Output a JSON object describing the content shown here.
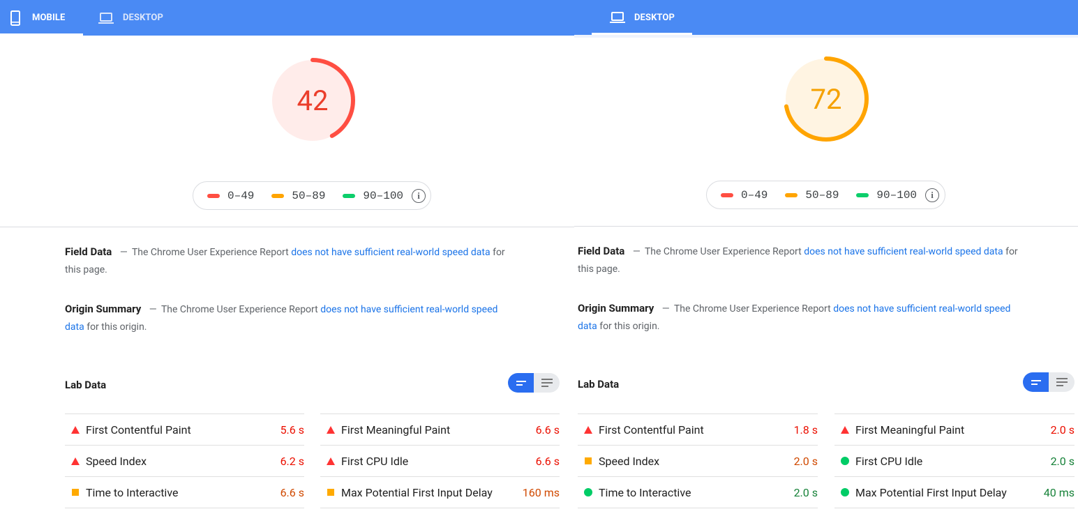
{
  "colors": {
    "fail": "#ff4e42",
    "average": "#ffa400",
    "pass": "#0cce6b",
    "fail_text": "#eb0f00",
    "average_text": "#d04900",
    "pass_text": "#178239",
    "link": "#1a73e8",
    "brand_blue": "#4a8af4"
  },
  "mobile_panel": {
    "tabs": [
      {
        "label": "MOBILE",
        "icon": "smartphone-icon",
        "active": true
      },
      {
        "label": "DESKTOP",
        "icon": "laptop-icon",
        "active": false
      }
    ],
    "score": {
      "value": 42,
      "fraction": 0.42,
      "rating": "fail"
    },
    "legend": {
      "ranges": [
        "0–49",
        "50–89",
        "90–100"
      ],
      "info_icon": "info-icon"
    },
    "field_data": {
      "heading": "Field Data",
      "dash": "—",
      "text_before": "The Chrome User Experience Report",
      "link_text": "does not have sufficient real-world speed data",
      "text_after": "for this page."
    },
    "origin_summary": {
      "heading": "Origin Summary",
      "dash": "—",
      "text_before": "The Chrome User Experience Report",
      "link_text": "does not have sufficient real-world speed data",
      "text_after": "for this origin."
    },
    "lab_data": {
      "title": "Lab Data",
      "metrics": [
        {
          "name": "First Contentful Paint",
          "value": "5.6 s",
          "rating": "fail"
        },
        {
          "name": "First Meaningful Paint",
          "value": "6.6 s",
          "rating": "fail"
        },
        {
          "name": "Speed Index",
          "value": "6.2 s",
          "rating": "fail"
        },
        {
          "name": "First CPU Idle",
          "value": "6.6 s",
          "rating": "fail"
        },
        {
          "name": "Time to Interactive",
          "value": "6.6 s",
          "rating": "average"
        },
        {
          "name": "Max Potential First Input Delay",
          "value": "160 ms",
          "rating": "average"
        }
      ]
    }
  },
  "desktop_panel": {
    "tabs": [
      {
        "label": "DESKTOP",
        "icon": "laptop-icon",
        "active": true
      }
    ],
    "score": {
      "value": 72,
      "fraction": 0.72,
      "rating": "average"
    },
    "legend": {
      "ranges": [
        "0–49",
        "50–89",
        "90–100"
      ],
      "info_icon": "info-icon"
    },
    "field_data": {
      "heading": "Field Data",
      "dash": "—",
      "text_before": "The Chrome User Experience Report",
      "link_text": "does not have sufficient real-world speed data",
      "text_after": "for this page."
    },
    "origin_summary": {
      "heading": "Origin Summary",
      "dash": "—",
      "text_before": "The Chrome User Experience Report",
      "link_text": "does not have sufficient real-world speed data",
      "text_after": "for this origin."
    },
    "lab_data": {
      "title": "Lab Data",
      "metrics": [
        {
          "name": "First Contentful Paint",
          "value": "1.8 s",
          "rating": "fail"
        },
        {
          "name": "First Meaningful Paint",
          "value": "2.0 s",
          "rating": "fail"
        },
        {
          "name": "Speed Index",
          "value": "2.0 s",
          "rating": "average"
        },
        {
          "name": "First CPU Idle",
          "value": "2.0 s",
          "rating": "pass"
        },
        {
          "name": "Time to Interactive",
          "value": "2.0 s",
          "rating": "pass"
        },
        {
          "name": "Max Potential First Input Delay",
          "value": "40 ms",
          "rating": "pass"
        }
      ]
    }
  }
}
